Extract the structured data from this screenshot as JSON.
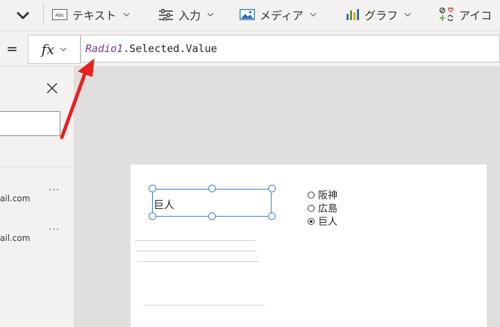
{
  "ribbon": {
    "items": [
      {
        "label": "テキスト",
        "icon": "text-label-icon"
      },
      {
        "label": "入力",
        "icon": "input-sliders-icon"
      },
      {
        "label": "メディア",
        "icon": "media-image-icon"
      },
      {
        "label": "グラフ",
        "icon": "chart-icon"
      },
      {
        "label": "アイコ",
        "icon": "icons-icon"
      }
    ],
    "text_icon_caption": "Abc"
  },
  "formula_bar": {
    "equals": "=",
    "fx": "fx",
    "formula_control": "Radio1",
    "formula_rest": ".Selected.Value"
  },
  "left_panel": {
    "rows": [
      {
        "email_partial": "ail.com",
        "more": "···"
      },
      {
        "email_partial": "ail.com",
        "more": "···"
      }
    ]
  },
  "canvas": {
    "text_input_value": "巨人",
    "radio_options": [
      {
        "label": "阪神",
        "selected": false
      },
      {
        "label": "広島",
        "selected": false
      },
      {
        "label": "巨人",
        "selected": true
      }
    ]
  },
  "colors": {
    "selection": "#3a7bc8",
    "annotation_arrow": "#e8201e",
    "control_name": "#7a3a8c"
  }
}
